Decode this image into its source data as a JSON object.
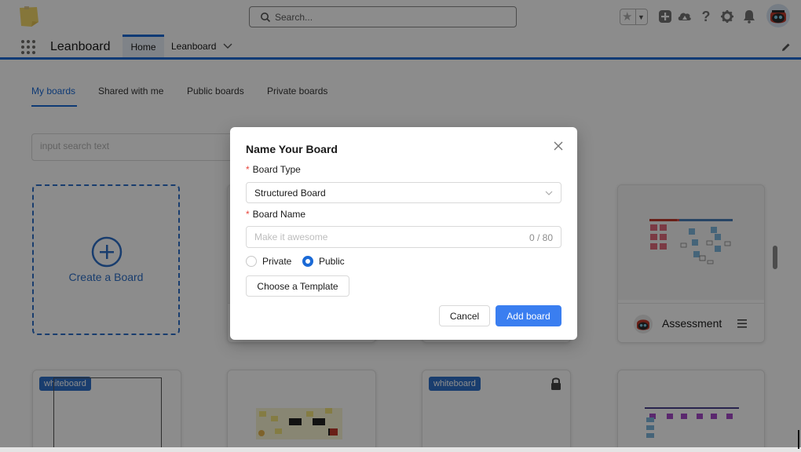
{
  "header": {
    "search_placeholder": "Search...",
    "icons": [
      "favorites-star-icon",
      "add-icon",
      "trailhead-icon",
      "help-icon",
      "setup-gear-icon",
      "notifications-bell-icon"
    ]
  },
  "nav": {
    "app_name": "Leanboard",
    "tabs": [
      {
        "label": "Home",
        "active": true
      },
      {
        "label": "Leanboard",
        "dropdown": true
      }
    ]
  },
  "boards_page": {
    "tabs": [
      {
        "label": "My boards",
        "active": true
      },
      {
        "label": "Shared with me"
      },
      {
        "label": "Public boards"
      },
      {
        "label": "Private boards"
      }
    ],
    "search_placeholder": "input search text",
    "create_label": "Create a Board",
    "cards": [
      {
        "name": "Assessment"
      },
      {
        "tag": "whiteboard"
      },
      {
        "tag": "whiteboard",
        "locked": true
      }
    ]
  },
  "modal": {
    "title": "Name Your Board",
    "board_type_label": "Board Type",
    "board_type_value": "Structured Board",
    "board_name_label": "Board Name",
    "board_name_placeholder": "Make it awesome",
    "board_name_counter": "0 / 80",
    "visibility": [
      {
        "label": "Private",
        "checked": false
      },
      {
        "label": "Public",
        "checked": true
      }
    ],
    "template_button": "Choose a Template",
    "cancel_button": "Cancel",
    "submit_button": "Add board"
  },
  "colors": {
    "accent": "#1b6ad6",
    "primary_button": "#3a7ef0",
    "required": "#e8453c"
  }
}
